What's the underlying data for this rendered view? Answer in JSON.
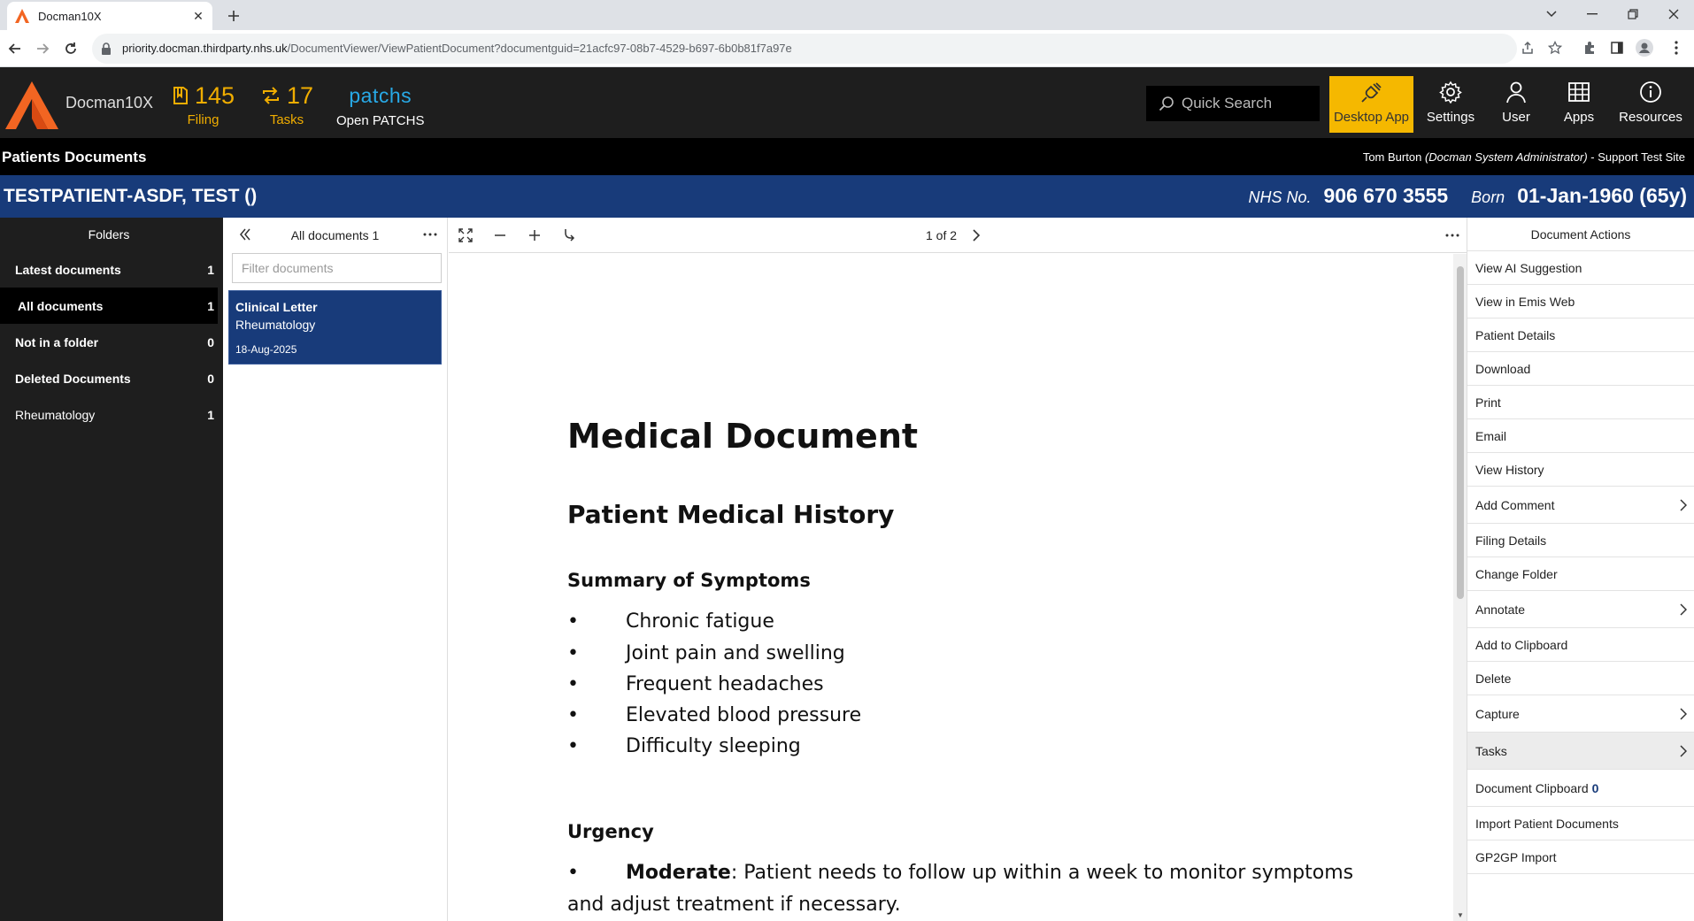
{
  "browser": {
    "tab_title": "Docman10X",
    "url_host": "priority.docman.thirdparty.nhs.uk",
    "url_path": "/DocumentViewer/ViewPatientDocument?documentguid=21acfc97-08b7-4529-b697-6b0b81f7a97e"
  },
  "header": {
    "brand": "Docman10X",
    "filing_count": "145",
    "filing_label": "Filing",
    "tasks_count": "17",
    "tasks_label": "Tasks",
    "patchs_logo": "patchs",
    "patchs_label": "Open PATCHS",
    "search_placeholder": "Quick Search",
    "buttons": {
      "desktop_app": "Desktop App",
      "settings": "Settings",
      "user": "User",
      "apps": "Apps",
      "resources": "Resources"
    },
    "accent_color": "#f5b800"
  },
  "subheader": {
    "title": "Patients Documents",
    "user_name": "Tom Burton",
    "user_role": "(Docman System Administrator)",
    "site": " - Support Test Site"
  },
  "patient": {
    "name": "TESTPATIENT-ASDF, TEST ()",
    "nhs_label": "NHS No.",
    "nhs_number": "906 670 3555",
    "born_label": "Born",
    "dob": "01-Jan-1960 (65y)",
    "bar_color": "#183b7a"
  },
  "folders": {
    "title": "Folders",
    "items": [
      {
        "label": "Latest documents",
        "count": "1"
      },
      {
        "label": "All documents",
        "count": "1"
      },
      {
        "label": "Not in a folder",
        "count": "0"
      },
      {
        "label": "Deleted Documents",
        "count": "0"
      },
      {
        "label": "Rheumatology",
        "count": "1"
      }
    ]
  },
  "doclist": {
    "title": "All documents 1",
    "filter_placeholder": "Filter documents",
    "card": {
      "type": "Clinical Letter",
      "folder": "Rheumatology",
      "date": "18-Aug-2025"
    }
  },
  "viewer": {
    "page_indicator": "1 of 2",
    "document": {
      "title": "Medical Document",
      "section": "Patient Medical History",
      "subsection": "Summary of Symptoms",
      "symptoms": [
        "Chronic fatigue",
        "Joint pain and swelling",
        "Frequent headaches",
        "Elevated blood pressure",
        "Difficulty sleeping"
      ],
      "bullet": "•",
      "urgency_heading": "Urgency",
      "urgency_level": "Moderate",
      "urgency_text": ": Patient needs to follow up within a week to monitor symptoms",
      "urgency_text_cont": "and adjust treatment if necessary."
    }
  },
  "actions": {
    "title": "Document Actions",
    "items": [
      {
        "label": "View AI Suggestion"
      },
      {
        "label": "View in Emis Web"
      },
      {
        "label": "Patient Details"
      },
      {
        "label": "Download"
      },
      {
        "label": "Print"
      },
      {
        "label": "Email"
      },
      {
        "label": "View History"
      },
      {
        "label": "Add Comment",
        "submenu": true
      },
      {
        "label": "Filing Details"
      },
      {
        "label": "Change Folder"
      },
      {
        "label": "Annotate",
        "submenu": true
      },
      {
        "label": "Add to Clipboard"
      },
      {
        "label": "Delete"
      },
      {
        "label": "Capture",
        "submenu": true
      },
      {
        "label": "Tasks",
        "submenu": true
      },
      {
        "label": "Document Clipboard",
        "count": "0"
      },
      {
        "label": "Import Patient Documents"
      },
      {
        "label": "GP2GP Import"
      }
    ]
  }
}
